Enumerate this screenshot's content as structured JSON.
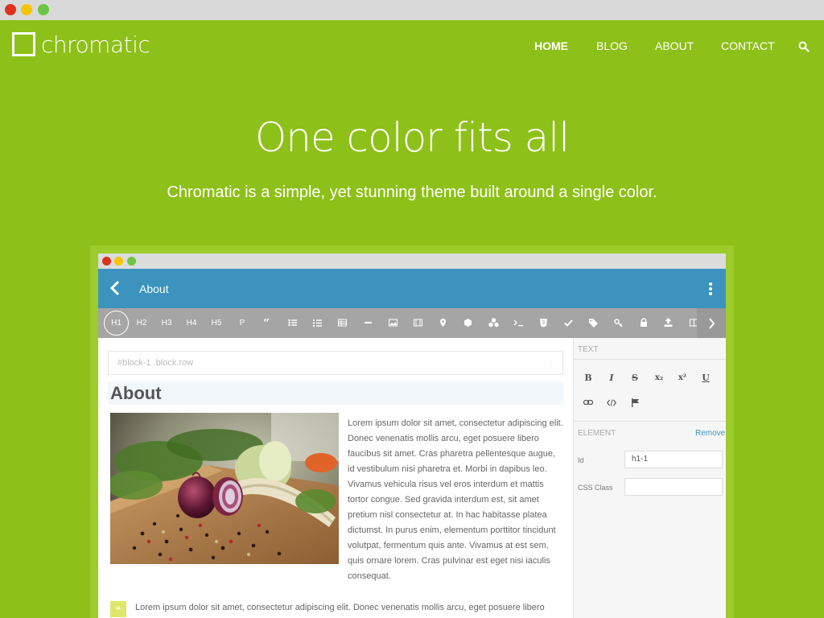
{
  "window": {
    "dots": [
      "#e0301e",
      "#f5c400",
      "#6cc644"
    ]
  },
  "site": {
    "logo": "chromatic",
    "nav": [
      {
        "label": "HOME",
        "active": true
      },
      {
        "label": "BLOG",
        "active": false
      },
      {
        "label": "ABOUT",
        "active": false
      },
      {
        "label": "CONTACT",
        "active": false
      }
    ],
    "search_icon": "search-icon"
  },
  "hero": {
    "title": "One color fits all",
    "subtitle": "Chromatic is a simple, yet stunning theme built around a single color."
  },
  "editor": {
    "app_title": "About",
    "toolbar": {
      "items": [
        "H1",
        "H2",
        "H3",
        "H4",
        "H5",
        "P"
      ],
      "icons": [
        "quote-icon",
        "bullet-list-icon",
        "numbered-list-icon",
        "table-icon",
        "horizontal-rule-icon",
        "image-icon",
        "video-icon",
        "map-pin-icon",
        "cube-icon",
        "cubes-icon",
        "terminal-icon",
        "html5-icon",
        "check-icon",
        "tags-icon",
        "key-icon",
        "lock-icon",
        "upload-icon",
        "columns-icon"
      ]
    },
    "block_path": "#block-1 .block.row",
    "heading": "About",
    "paragraph": "Lorem ipsum dolor sit amet, consectetur adipiscing elit. Donec venenatis mollis arcu, eget posuere libero faucibus sit amet. Cras pharetra pellentesque augue, id vestibulum nisi pharetra et. Morbi in dapibus leo. Vivamus vehicula risus vel eros interdum et mattis tortor congue. Sed gravida interdum est, sit amet pretium nisl consectetur at. In hac habitasse platea dictumst. In purus enim, elementum porttitor tincidunt volutpat, fermentum quis ante. Vivamus at est sem, quis ornare lorem. Cras pulvinar est eget nisi iaculis consequat.",
    "quote": "Lorem ipsum dolor sit amet, consectetur adipiscing elit. Donec venenatis mollis arcu, eget posuere libero",
    "panel": {
      "text_label": "TEXT",
      "format_buttons": [
        "B",
        "I",
        "S",
        "x₂",
        "x²",
        "U"
      ],
      "element_label": "ELEMENT",
      "remove_label": "Remove",
      "id_label": "Id",
      "id_value": "h1-1",
      "css_label": "CSS Class",
      "css_value": ""
    }
  },
  "colors": {
    "brand": "#8dc018",
    "app_bar": "#3c93be",
    "toolbar": "#a5a5a5"
  }
}
